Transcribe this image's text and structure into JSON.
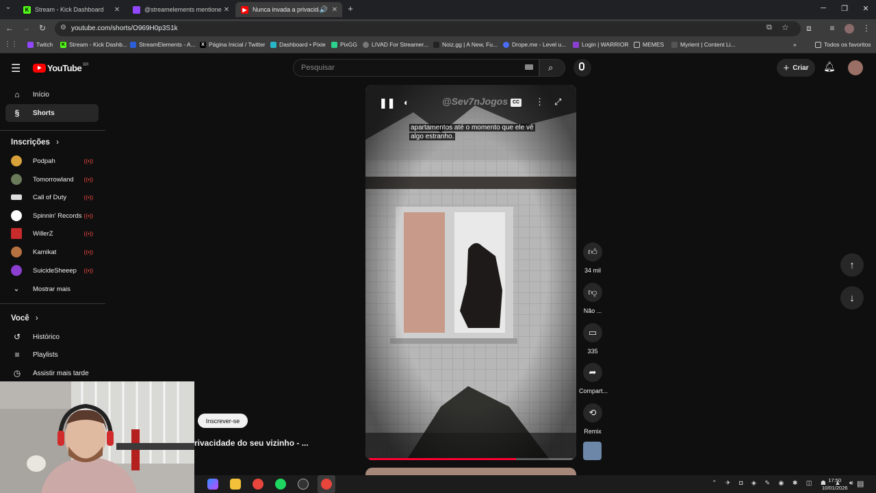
{
  "browser": {
    "tabs": [
      {
        "label": "Stream - Kick Dashboard",
        "favicon": "K",
        "color": "#53fc18"
      },
      {
        "label": "@streamelements mentione",
        "favicon": "twitch",
        "color": "#9146ff"
      },
      {
        "label": "Nunca invada a privacidade",
        "favicon": "yt",
        "color": "#ff0000",
        "active": true
      }
    ],
    "url": "youtube.com/shorts/O969H0p3S1k",
    "bookmarks": [
      "Twitch",
      "Stream - Kick Dashb...",
      "StreamElements - A...",
      "Página Inicial / Twitter",
      "Dashboard • Pixie",
      "PixGG",
      "LIVAD For Streamer...",
      "Noiz.gg | A New, Fu...",
      "Drope.me - Level u...",
      "Login | WARRIOR",
      "MEMES",
      "Myrient | Content Li..."
    ],
    "all_bookmarks": "Todos os favoritos"
  },
  "youtube": {
    "logo": "YouTube",
    "region": "BR",
    "search_placeholder": "Pesquisar",
    "create_label": "Criar",
    "nav": [
      {
        "label": "Início",
        "icon": "home-icon"
      },
      {
        "label": "Shorts",
        "icon": "shorts-icon",
        "selected": true
      }
    ],
    "subscriptions_title": "Inscrições",
    "subscriptions": [
      {
        "name": "Podpah",
        "color": "#d8a23b"
      },
      {
        "name": "Tomorrowland",
        "color": "#6a7b5a"
      },
      {
        "name": "Call of Duty",
        "color": "#dddddd"
      },
      {
        "name": "Spinnin' Records",
        "color": "#ffffff"
      },
      {
        "name": "WillerZ",
        "color": "#c72b2b"
      },
      {
        "name": "Kamikat",
        "color": "#b5713f"
      },
      {
        "name": "SuicideSheeep",
        "color": "#8b3fd0"
      }
    ],
    "show_more": "Mostrar mais",
    "you_title": "Você",
    "you_items": [
      {
        "label": "Histórico",
        "icon": "history-icon"
      },
      {
        "label": "Playlists",
        "icon": "playlists-icon"
      },
      {
        "label": "Assistir mais tarde",
        "icon": "watch-later-icon"
      }
    ]
  },
  "short": {
    "watermark": "@Sev7nJogos",
    "caption_line1": "apartamentos até o momento que ele vê",
    "caption_line2": "algo estranho.",
    "progress": 0.72,
    "title": "rivacidade do seu vizinho - ...",
    "subscribe_label": "Inscrever-se",
    "likes": "34 mil",
    "dislike_label": "Não ...",
    "comments": "335",
    "share_label": "Compart...",
    "remix_label": "Remix"
  },
  "taskbar": {
    "time": "17:50",
    "date": "10/01/2026"
  }
}
